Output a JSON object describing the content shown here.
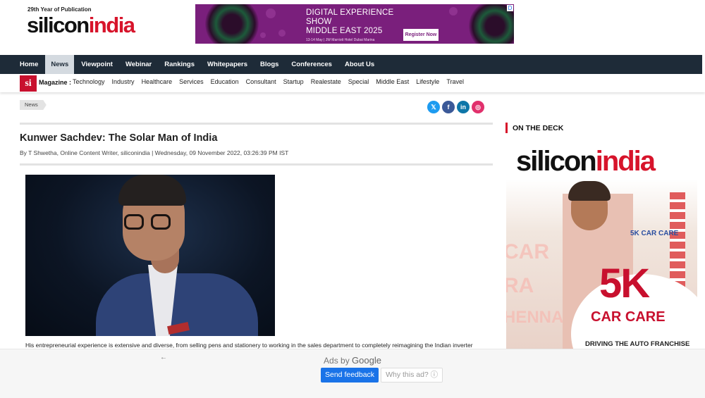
{
  "header": {
    "logo_sup": "29th Year of Publication",
    "logo_part1": "silicon",
    "logo_part2": "india"
  },
  "banner_ad": {
    "line1": "DIGITAL EXPERIENCE",
    "line2": "SHOW",
    "line3": "MIDDLE EAST 2025",
    "details": "13-14 May | JW Marriott Hotel Dubai Marina",
    "cta": "Register Now",
    "ad_choice": "D"
  },
  "nav": {
    "items": [
      "Home",
      "News",
      "Viewpoint",
      "Webinar",
      "Rankings",
      "Whitepapers",
      "Blogs",
      "Conferences",
      "About Us"
    ],
    "active": "News"
  },
  "subnav": {
    "logo": "si",
    "label": "Magazine :",
    "items": [
      "Technology",
      "Industry",
      "Healthcare",
      "Services",
      "Education",
      "Consultant",
      "Startup",
      "Realestate",
      "Special",
      "Middle East",
      "Lifestyle",
      "Travel"
    ]
  },
  "breadcrumb": "News",
  "social": [
    "𝕏",
    "f",
    "in",
    "◎"
  ],
  "article": {
    "title": "Kunwer Sachdev: The Solar Man of India",
    "byline": "By T Shwetha, Online Content Writer, siliconindia  |  Wednesday, 09 November 2022, 03:26:39 PM IST",
    "paragraph": "His entrepreneurial experience is extensive and diverse, from selling pens and stationery to working in the sales department to completely reimagining the Indian inverter"
  },
  "sidebar": {
    "heading": "ON THE DECK",
    "cover": {
      "logo_part1": "silicon",
      "logo_part2": "india",
      "brand": "5K CAR CARE",
      "headline": "5K",
      "subhead": "CAR CARE",
      "bg_word1": "CAR",
      "bg_word2": "RA",
      "bg_word3": "HENNAI",
      "tagline": "DRIVING THE AUTO FRANCHISE"
    }
  },
  "ad_footer": {
    "back": "←",
    "ads_by": "Ads by",
    "google": "Google",
    "feedback": "Send feedback",
    "why": "Why this ad? ⓘ"
  }
}
